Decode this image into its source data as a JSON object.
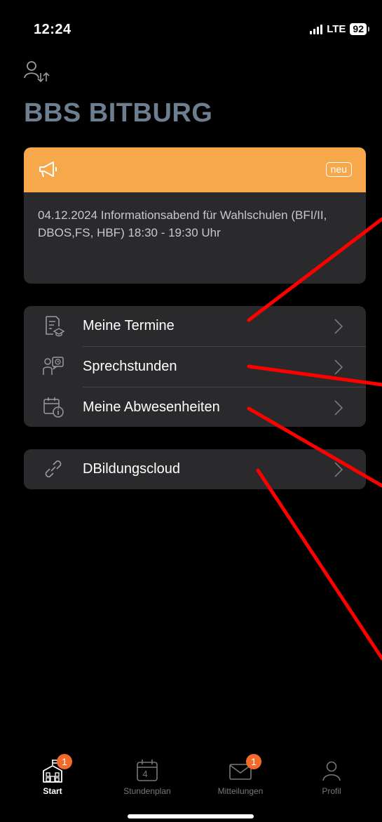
{
  "status_bar": {
    "time": "12:24",
    "network": "LTE",
    "battery": "92"
  },
  "header": {
    "title": "BBS BITBURG",
    "switch_icon": "switch-user-icon"
  },
  "announcement": {
    "icon": "megaphone-icon",
    "badge": "neu",
    "text": "04.12.2024 Informationsabend für Wahlschulen (BFI/II, DBOS,FS, HBF) 18:30 - 19:30 Uhr",
    "header_color": "#f7a84a"
  },
  "menu": {
    "items": [
      {
        "label": "Meine Termine",
        "icon": "calendar-document-icon"
      },
      {
        "label": "Sprechstunden",
        "icon": "consultation-icon"
      },
      {
        "label": "Meine Abwesenheiten",
        "icon": "absence-calendar-icon"
      }
    ]
  },
  "cloud": {
    "label": "DBildungscloud",
    "icon": "link-icon"
  },
  "tabbar": {
    "tabs": [
      {
        "label": "Start",
        "badge": "1",
        "active": true
      },
      {
        "label": "Stundenplan",
        "day": "4"
      },
      {
        "label": "Mitteilungen",
        "badge": "1"
      },
      {
        "label": "Profil"
      }
    ],
    "badge_color": "#f26b2a"
  },
  "annotation_color": "#ff0000"
}
